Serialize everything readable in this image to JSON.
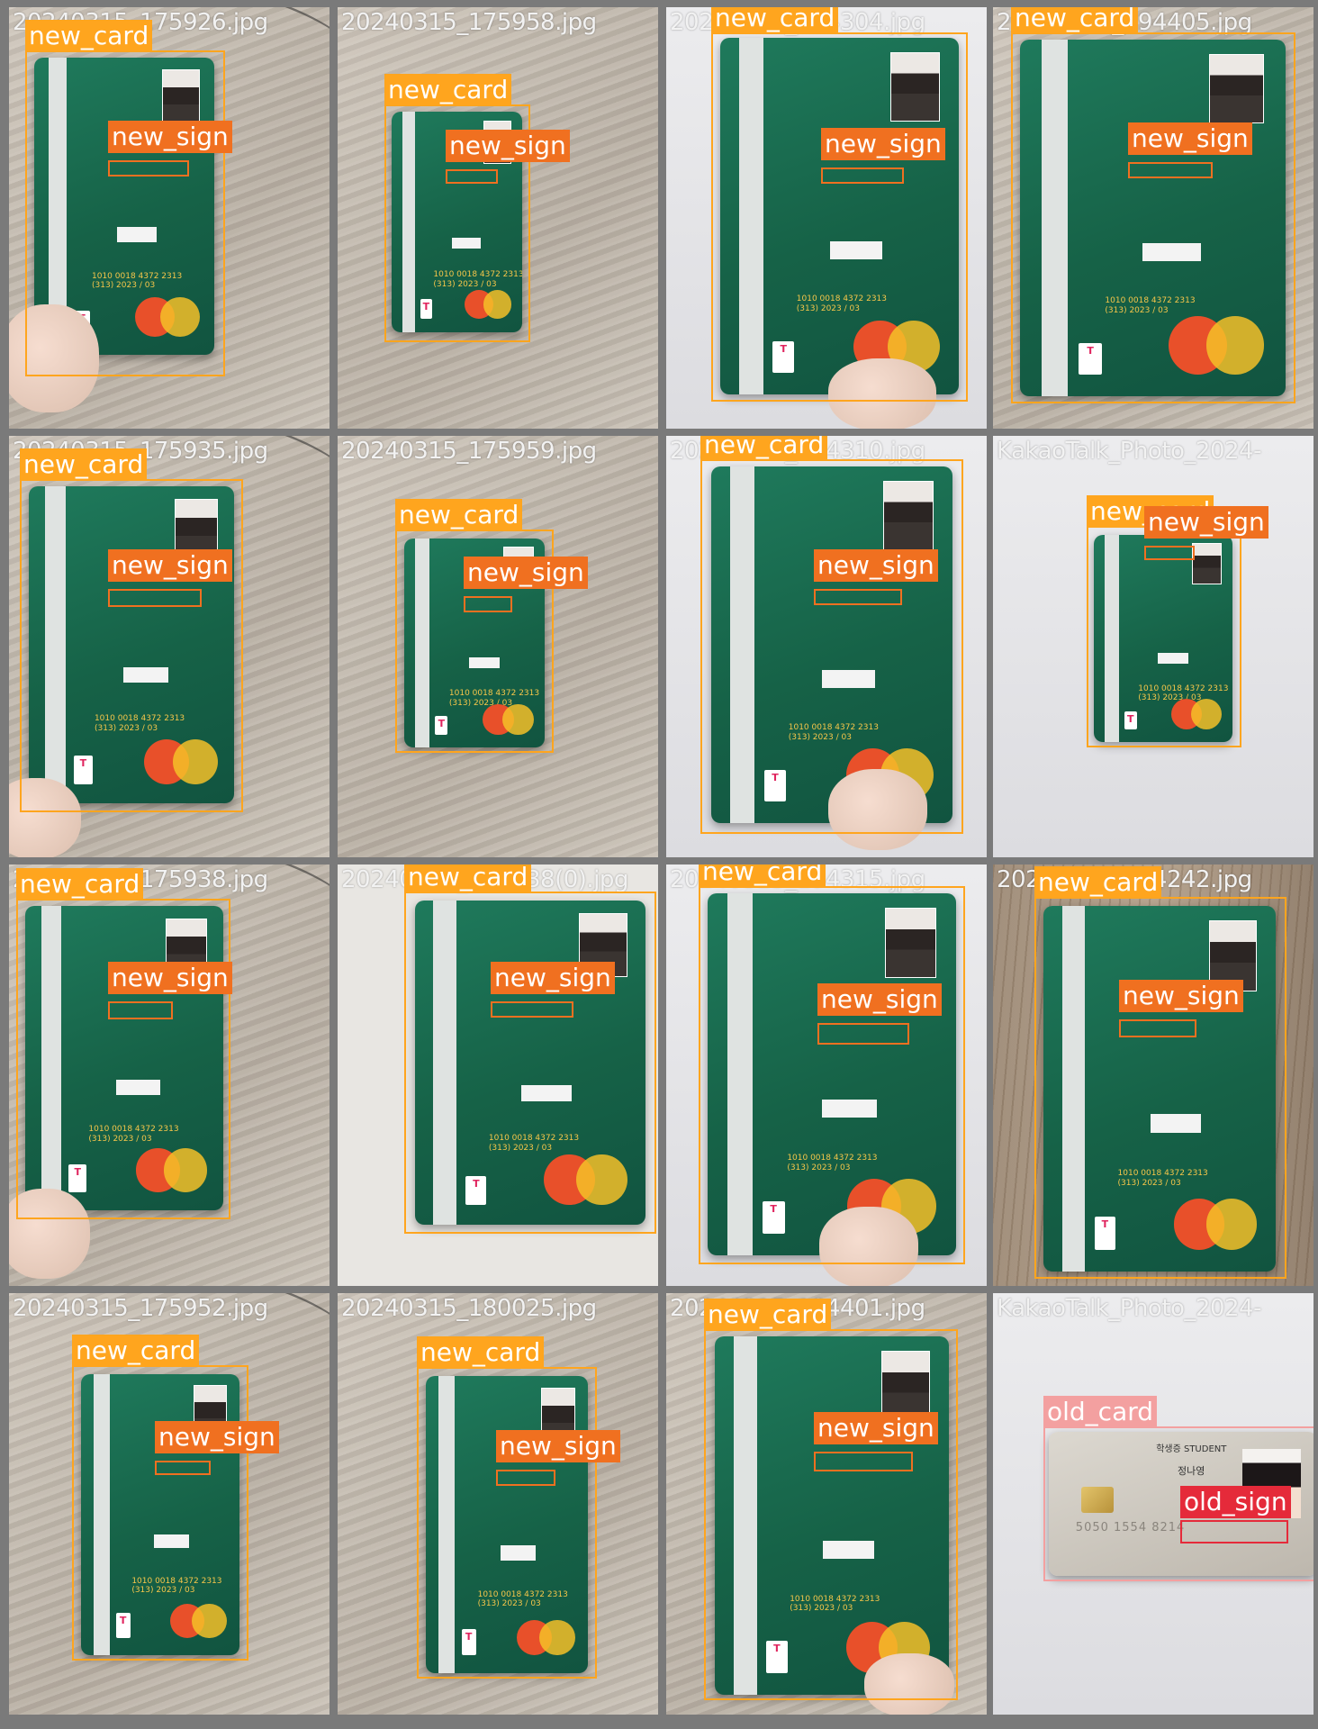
{
  "tiles": [
    {
      "filename": "20240315_175926.jpg",
      "bg": "desk"
    },
    {
      "filename": "20240315_175958.jpg",
      "bg": "desk"
    },
    {
      "filename": "20240315_194304.jpg",
      "bg": "white"
    },
    {
      "filename": "20240315_194405.jpg",
      "bg": "desk"
    },
    {
      "filename": "20240315_175935.jpg",
      "bg": "desk"
    },
    {
      "filename": "20240315_175959.jpg",
      "bg": "desk"
    },
    {
      "filename": "20240315_194310.jpg",
      "bg": "white"
    },
    {
      "filename": "KakaoTalk_Photo_2024-",
      "bg": "white"
    },
    {
      "filename": "20240315_175938.jpg",
      "bg": "desk"
    },
    {
      "filename": "20240315_180538(0).jpg",
      "bg": "print"
    },
    {
      "filename": "20240315_194315.jpg",
      "bg": "white"
    },
    {
      "filename": "20240315_194242.jpg",
      "bg": "wood"
    },
    {
      "filename": "20240315_175952.jpg",
      "bg": "desk"
    },
    {
      "filename": "20240315_180025.jpg",
      "bg": "desk"
    },
    {
      "filename": "20240315_194401.jpg",
      "bg": "desk"
    },
    {
      "filename": "KakaoTalk_Photo_2024-",
      "bg": "white"
    }
  ],
  "labels": {
    "new_card": "new_card",
    "new_sign": "new_sign",
    "old_card": "old_card",
    "old_sign": "old_sign"
  },
  "card": {
    "digits_line1": "1010  0018  4372  2313",
    "digits_line2": "(313)  2023 / 03",
    "tmoney": "T",
    "old_header": "학생증 STUDENT",
    "old_name": "정나영",
    "old_number": "5050 1554 8214"
  },
  "colors": {
    "new_card": "#ffa51e",
    "new_sign": "#f07020",
    "old_card": "#f3a0a0",
    "old_sign": "#e52a3a",
    "card_green": "#166247"
  }
}
